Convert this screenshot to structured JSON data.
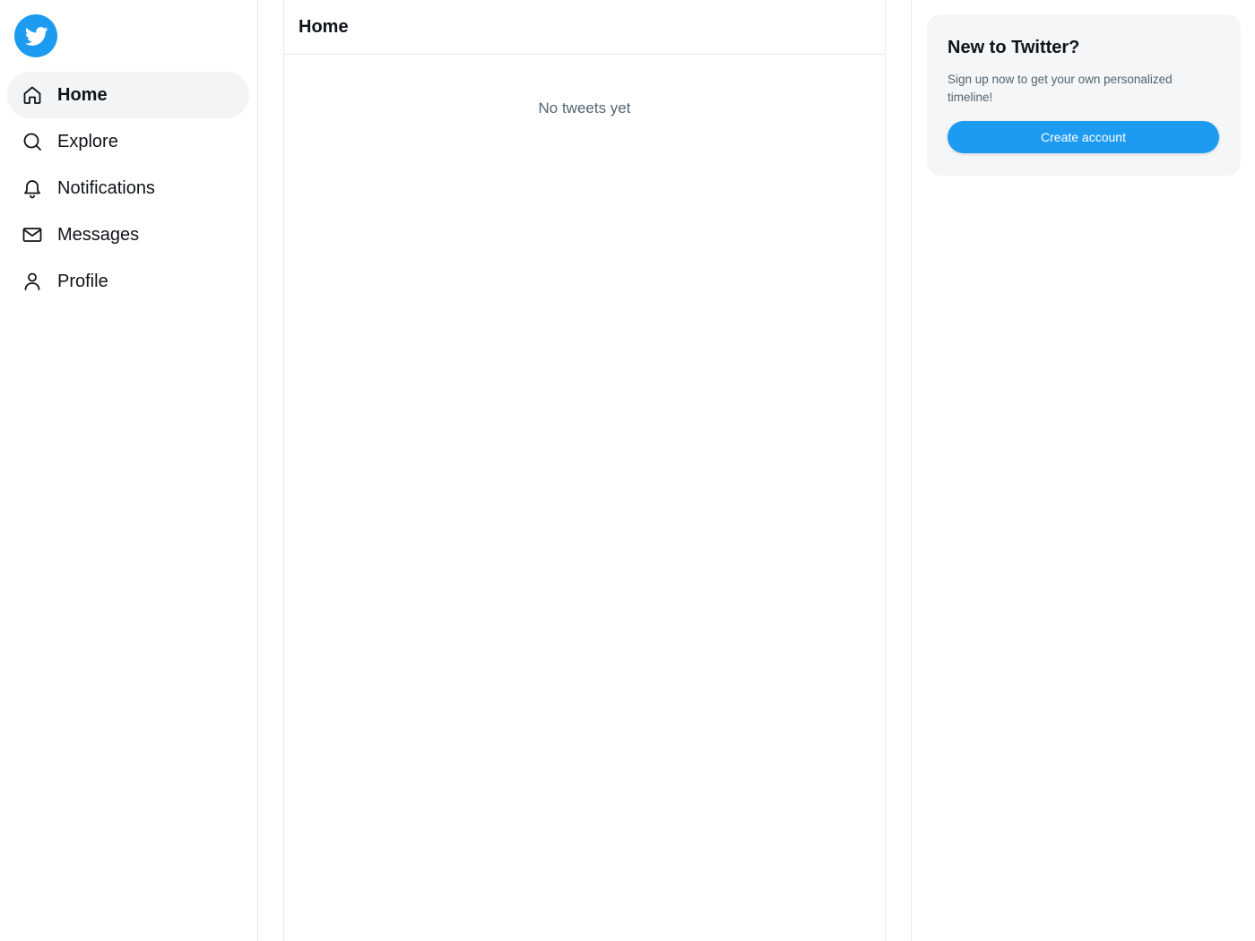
{
  "brand": {
    "logo_icon": "twitter-bird-icon",
    "accent_color": "#1d9bf0"
  },
  "sidebar": {
    "items": [
      {
        "label": "Home",
        "icon": "home-icon",
        "active": true
      },
      {
        "label": "Explore",
        "icon": "search-icon",
        "active": false
      },
      {
        "label": "Notifications",
        "icon": "bell-icon",
        "active": false
      },
      {
        "label": "Messages",
        "icon": "mail-icon",
        "active": false
      },
      {
        "label": "Profile",
        "icon": "user-icon",
        "active": false
      }
    ]
  },
  "main": {
    "title": "Home",
    "empty_message": "No tweets yet"
  },
  "signup": {
    "title": "New to Twitter?",
    "description": "Sign up now to get your own personalized timeline!",
    "button_label": "Create account"
  }
}
